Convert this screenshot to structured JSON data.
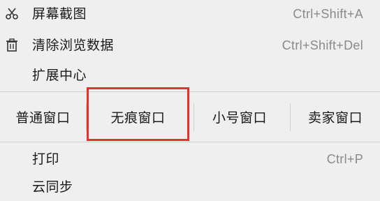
{
  "menu": {
    "top_items": [
      {
        "label": "屏幕截图",
        "shortcut": "Ctrl+Shift+A",
        "icon": "scissors-icon"
      },
      {
        "label": "清除浏览数据",
        "shortcut": "Ctrl+Shift+Del",
        "icon": "trash-icon"
      },
      {
        "label": "扩展中心",
        "shortcut": "",
        "icon": ""
      }
    ],
    "window_modes": [
      "普通窗口",
      "无痕窗口",
      "小号窗口",
      "卖家窗口"
    ],
    "highlighted_mode": "无痕窗口",
    "bottom_items": [
      {
        "label": "打印",
        "shortcut": "Ctrl+P"
      },
      {
        "label": "云同步",
        "shortcut": ""
      }
    ]
  },
  "colors": {
    "background": "#efefef",
    "shortcut_text": "#8a8a8a",
    "highlight_border": "#e8302f"
  }
}
